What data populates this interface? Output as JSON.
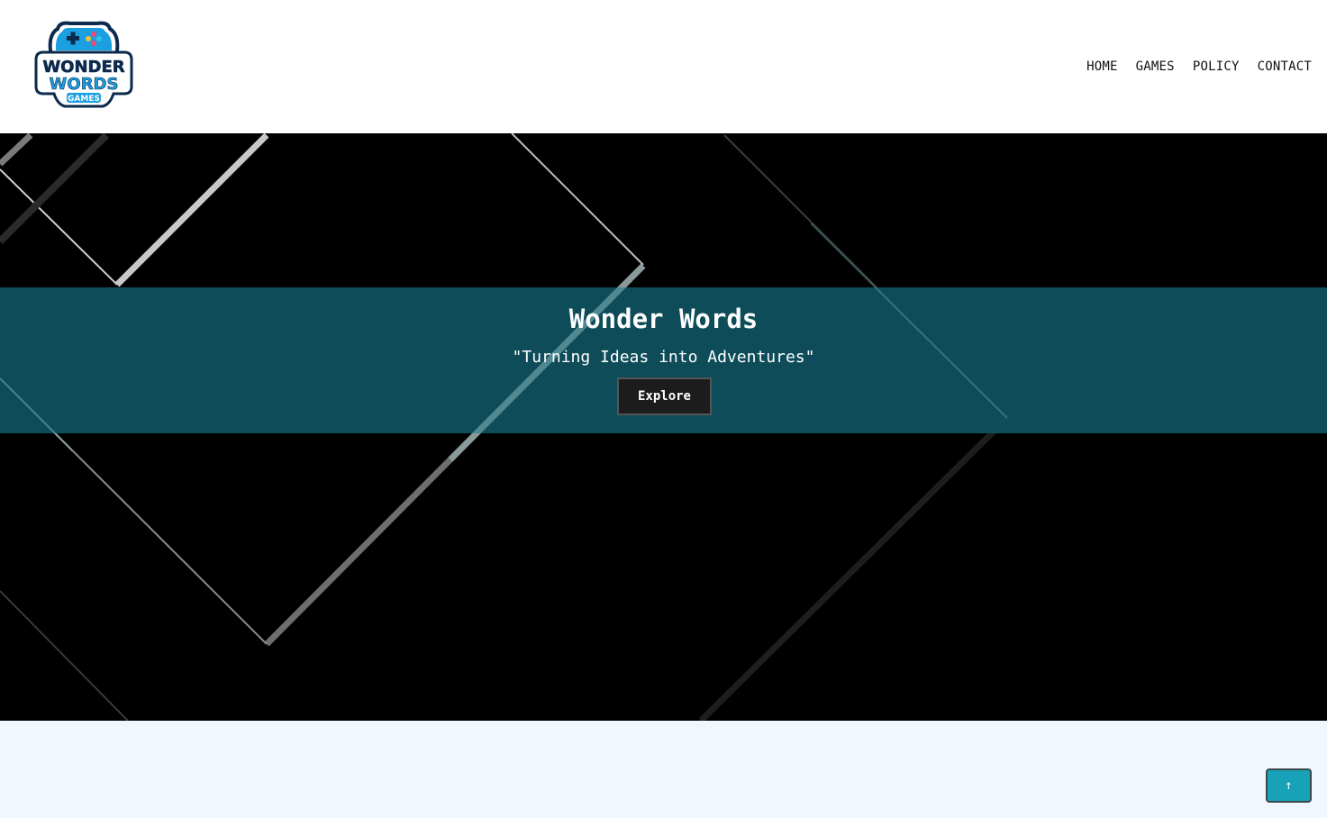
{
  "logo": {
    "line1": "WONDER",
    "line2": "WORDS",
    "line3": "GAMES"
  },
  "nav": {
    "items": [
      {
        "label": "HOME"
      },
      {
        "label": "GAMES"
      },
      {
        "label": "POLICY"
      },
      {
        "label": "CONTACT"
      }
    ]
  },
  "hero": {
    "title": "Wonder Words",
    "subtitle": "\"Turning Ideas into Adventures\"",
    "button_label": "Explore"
  },
  "scroll_top": {
    "label": "↑"
  },
  "colors": {
    "band": "#0e5260",
    "accent": "#17a2b8",
    "logo_blue": "#1a9fe0",
    "logo_navy": "#0c2a4d"
  }
}
